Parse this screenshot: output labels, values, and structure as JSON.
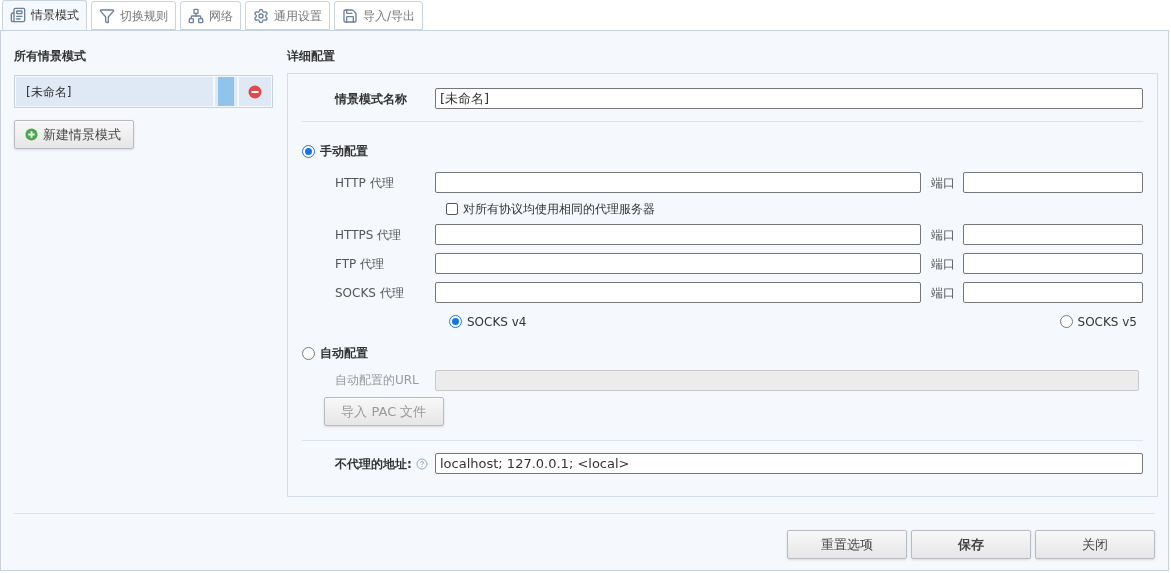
{
  "tabs": [
    {
      "label": "情景模式",
      "kind": "profile",
      "selected": true
    },
    {
      "label": "切换规则",
      "kind": "filter",
      "selected": false
    },
    {
      "label": "网络",
      "kind": "network",
      "selected": false
    },
    {
      "label": "通用设置",
      "kind": "gear",
      "selected": false
    },
    {
      "label": "导入/导出",
      "kind": "disk",
      "selected": false
    }
  ],
  "profiles": {
    "title": "所有情景模式",
    "items": [
      {
        "name": "[未命名]",
        "selected": true,
        "color": "#90c4ec"
      }
    ],
    "new_button": "新建情景模式"
  },
  "detail": {
    "title": "详细配置",
    "name_label": "情景模式名称",
    "name_value": "[未命名]",
    "manual": {
      "label": "手动配置",
      "selected": true
    },
    "proxies": [
      {
        "label": "HTTP 代理",
        "port_label": "端口"
      },
      {
        "label": "HTTPS 代理",
        "port_label": "端口"
      },
      {
        "label": "FTP 代理",
        "port_label": "端口"
      },
      {
        "label": "SOCKS 代理",
        "port_label": "端口"
      }
    ],
    "same_for_all": {
      "label": "对所有协议均使用相同的代理服务器",
      "checked": false
    },
    "socks_versions": [
      {
        "label": "SOCKS v4",
        "selected": true
      },
      {
        "label": "SOCKS v5",
        "selected": false
      }
    ],
    "auto": {
      "label": "自动配置",
      "selected": false,
      "url_label": "自动配置的URL",
      "disabled": true,
      "import_button": "导入 PAC 文件"
    },
    "bypass_label": "不代理的地址:",
    "bypass_value": "localhost; 127.0.0.1; <local>"
  },
  "buttons": [
    {
      "label": "重置选项",
      "primary": false
    },
    {
      "label": "保存",
      "primary": true
    },
    {
      "label": "关闭",
      "primary": false
    }
  ]
}
